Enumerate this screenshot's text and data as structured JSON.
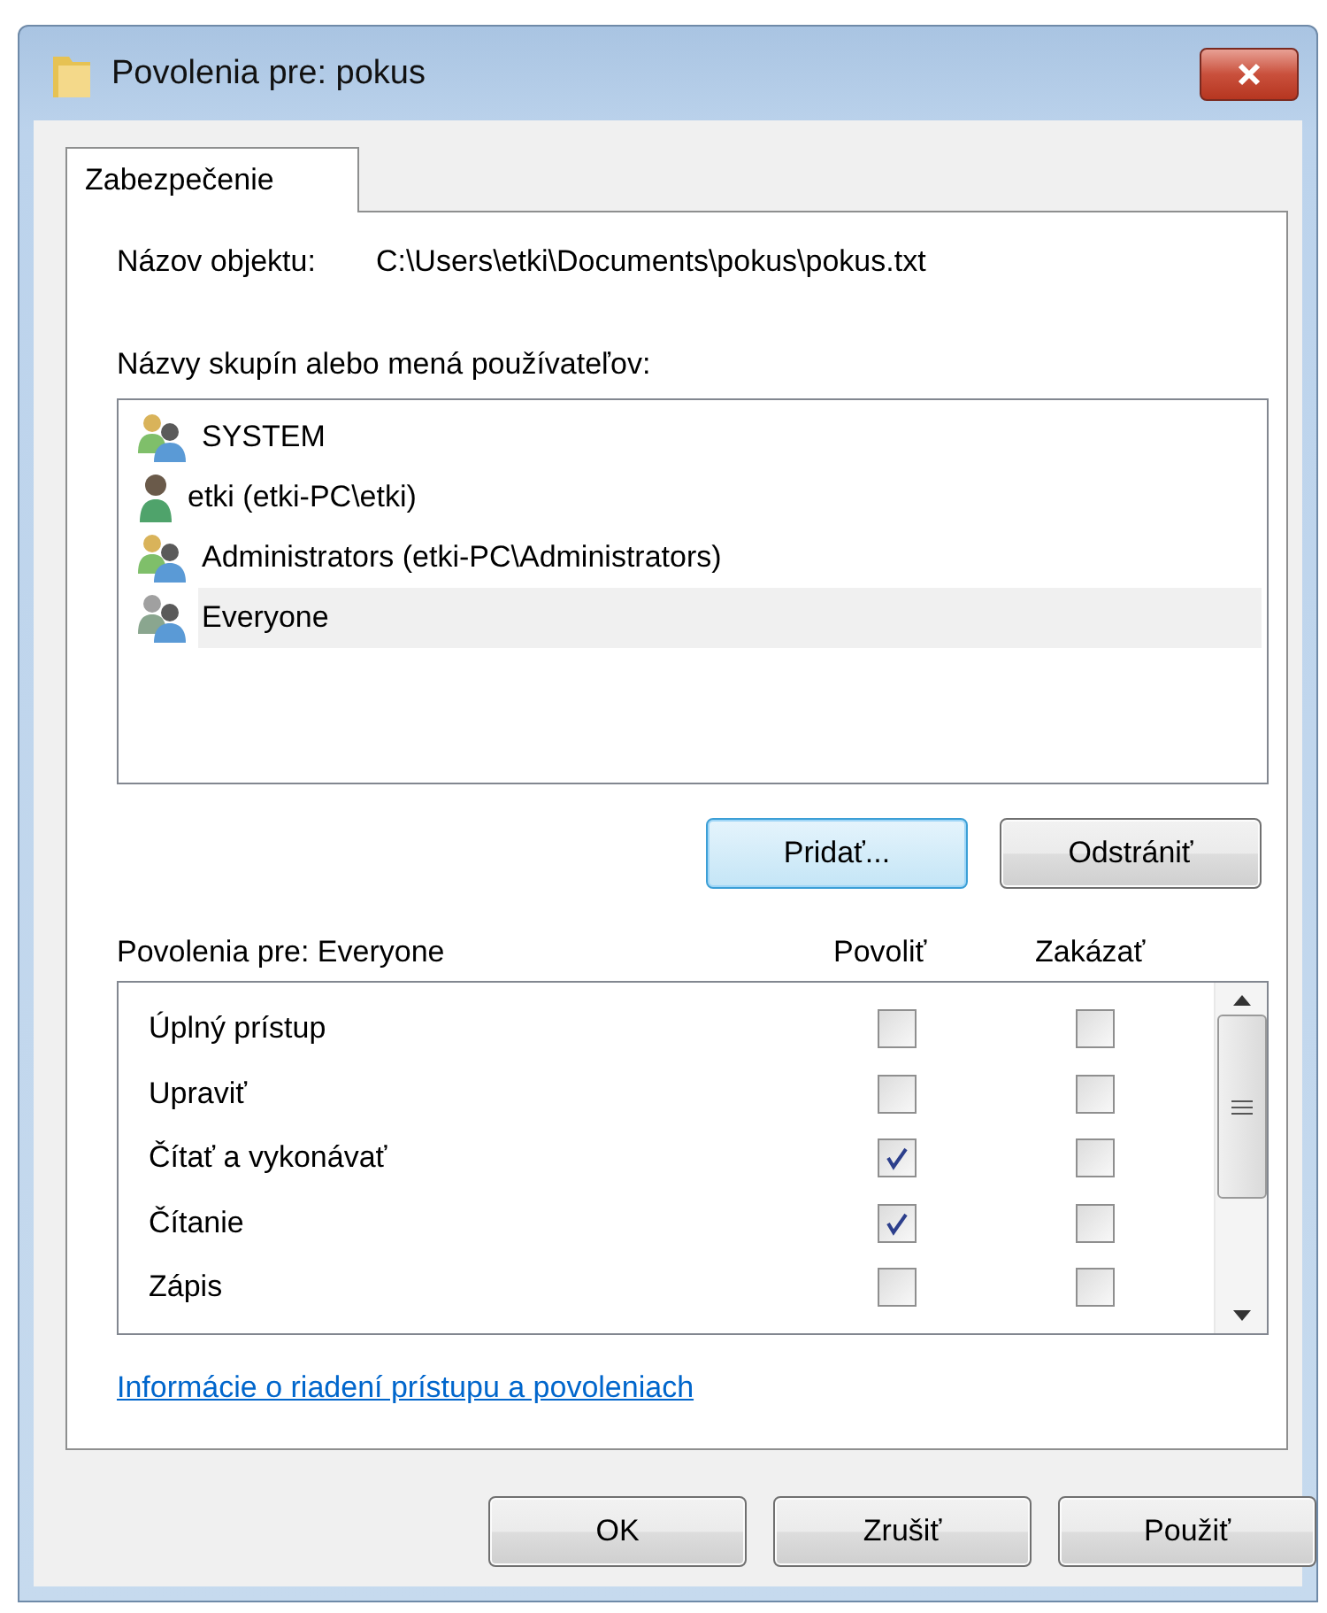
{
  "window": {
    "title": "Povolenia pre: pokus"
  },
  "tabs": [
    {
      "label": "Zabezpečenie",
      "selected": true
    }
  ],
  "object_name": {
    "label": "Názov objektu:",
    "value": "C:\\Users\\etki\\Documents\\pokus\\pokus.txt"
  },
  "principals": {
    "label": "Názvy skupín alebo mená používateľov:",
    "items": [
      {
        "name": "SYSTEM",
        "kind": "group",
        "selected": false
      },
      {
        "name": "etki (etki-PC\\etki)",
        "kind": "user",
        "selected": false
      },
      {
        "name": "Administrators (etki-PC\\Administrators)",
        "kind": "group",
        "selected": false
      },
      {
        "name": "Everyone",
        "kind": "everyone",
        "selected": true
      }
    ],
    "buttons": [
      {
        "label": "Pridať...",
        "focused": true
      },
      {
        "label": "Odstrániť",
        "focused": false
      }
    ]
  },
  "permissions": {
    "label": "Povolenia pre: Everyone",
    "allow_header": "Povoliť",
    "deny_header": "Zakázať",
    "rows": [
      {
        "name": "Úplný prístup",
        "allow": false,
        "deny": false
      },
      {
        "name": "Upraviť",
        "allow": false,
        "deny": false
      },
      {
        "name": "Čítať a vykonávať",
        "allow": true,
        "deny": false
      },
      {
        "name": "Čítanie",
        "allow": true,
        "deny": false
      },
      {
        "name": "Zápis",
        "allow": false,
        "deny": false
      }
    ]
  },
  "link": "Informácie o riadení prístupu a povoleniach",
  "buttons": [
    "OK",
    "Zrušiť",
    "Použiť"
  ]
}
